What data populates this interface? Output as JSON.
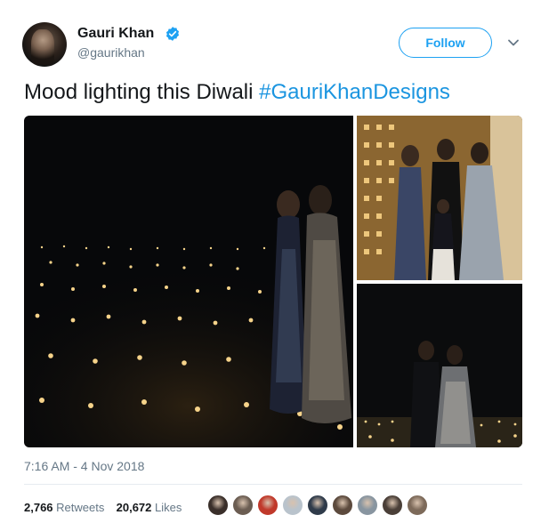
{
  "author": {
    "name": "Gauri Khan",
    "handle": "@gaurikhan",
    "verified_icon": "verified-badge-icon"
  },
  "follow_button": {
    "label": "Follow"
  },
  "tweet": {
    "text": "Mood lighting this Diwali ",
    "hashtag": "#GauriKhanDesigns",
    "timestamp": "7:16 AM - 4 Nov 2018"
  },
  "stats": {
    "retweets_count": "2,766",
    "retweets_label": "Retweets",
    "likes_count": "20,672",
    "likes_label": "Likes"
  },
  "colors": {
    "accent": "#1da1f2",
    "hashtag": "#1b95e0",
    "muted": "#657786",
    "text": "#14171a"
  },
  "liker_avatars": [
    "#3a2f2a",
    "#6b5d52",
    "#c0392b",
    "#b9c3cc",
    "#2f3b4a",
    "#5c4a3d",
    "#8895a0",
    "#4a3f38",
    "#7d6a5a"
  ]
}
